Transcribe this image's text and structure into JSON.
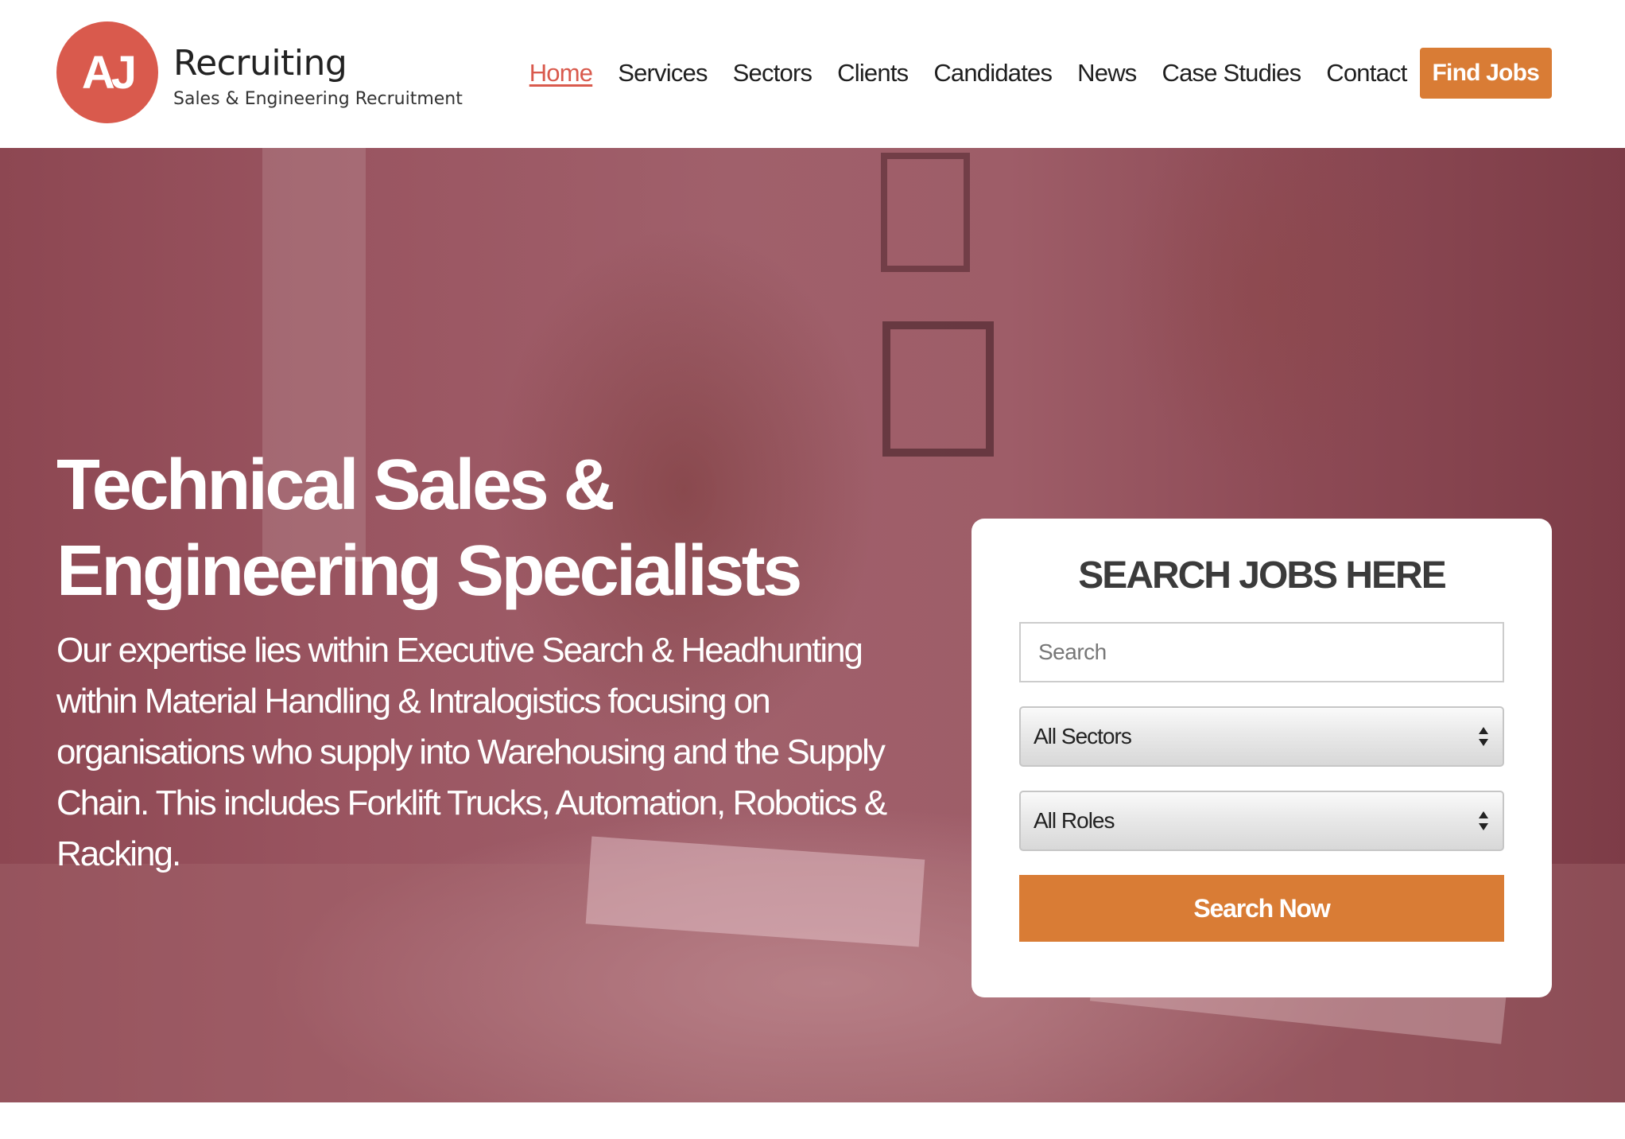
{
  "brand": {
    "logo_initials": "AJ",
    "name": "Recruiting",
    "tagline": "Sales & Engineering Recruitment",
    "logo_color": "#d95a4d"
  },
  "nav": {
    "items": [
      {
        "label": "Home",
        "active": true
      },
      {
        "label": "Services"
      },
      {
        "label": "Sectors"
      },
      {
        "label": "Clients"
      },
      {
        "label": "Candidates"
      },
      {
        "label": "News"
      },
      {
        "label": "Case Studies"
      },
      {
        "label": "Contact"
      }
    ],
    "cta_label": "Find Jobs",
    "active_color": "#d95a4d",
    "cta_color": "#d97c35"
  },
  "hero": {
    "title_line1": "Technical Sales &",
    "title_line2": "Engineering Specialists",
    "description": "Our expertise lies within Executive Search & Headhunting within Material Handling & Intralogistics focusing on organisations who supply into Warehousing and the Supply Chain. This includes Forklift Trucks, Automation, Robotics & Racking.",
    "overlay_color": "#9a5561"
  },
  "search": {
    "heading": "SEARCH JOBS HERE",
    "input_placeholder": "Search",
    "input_value": "",
    "sectors_selected": "All Sectors",
    "roles_selected": "All Roles",
    "button_label": "Search Now",
    "button_color": "#d97c35"
  }
}
